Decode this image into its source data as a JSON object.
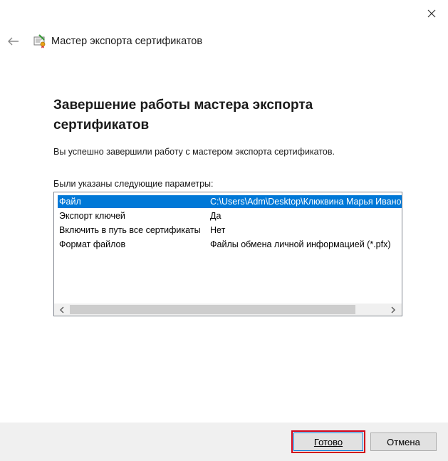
{
  "window": {
    "title": "Мастер экспорта сертификатов"
  },
  "main": {
    "heading": "Завершение работы мастера экспорта сертификатов",
    "success_message": "Вы успешно завершили работу с мастером экспорта сертификатов.",
    "params_label": "Были указаны следующие параметры:"
  },
  "params": [
    {
      "name": "Файл",
      "value": "C:\\Users\\Adm\\Desktop\\Клюквина Марья Ивановна.pfx",
      "selected": true
    },
    {
      "name": "Экспорт ключей",
      "value": "Да",
      "selected": false
    },
    {
      "name": "Включить в путь все сертификаты",
      "value": "Нет",
      "selected": false
    },
    {
      "name": "Формат файлов",
      "value": "Файлы обмена личной информацией (*.pfx)",
      "selected": false
    }
  ],
  "footer": {
    "done_label": "Готово",
    "cancel_label": "Отмена"
  },
  "icons": {
    "close": "close-icon",
    "back": "back-arrow-icon",
    "certificate": "certificate-icon",
    "scroll_left": "scroll-left-icon",
    "scroll_right": "scroll-right-icon"
  },
  "colors": {
    "selection": "#0078d7",
    "highlight_box": "#d0021b",
    "footer_bg": "#f0f0f0"
  }
}
